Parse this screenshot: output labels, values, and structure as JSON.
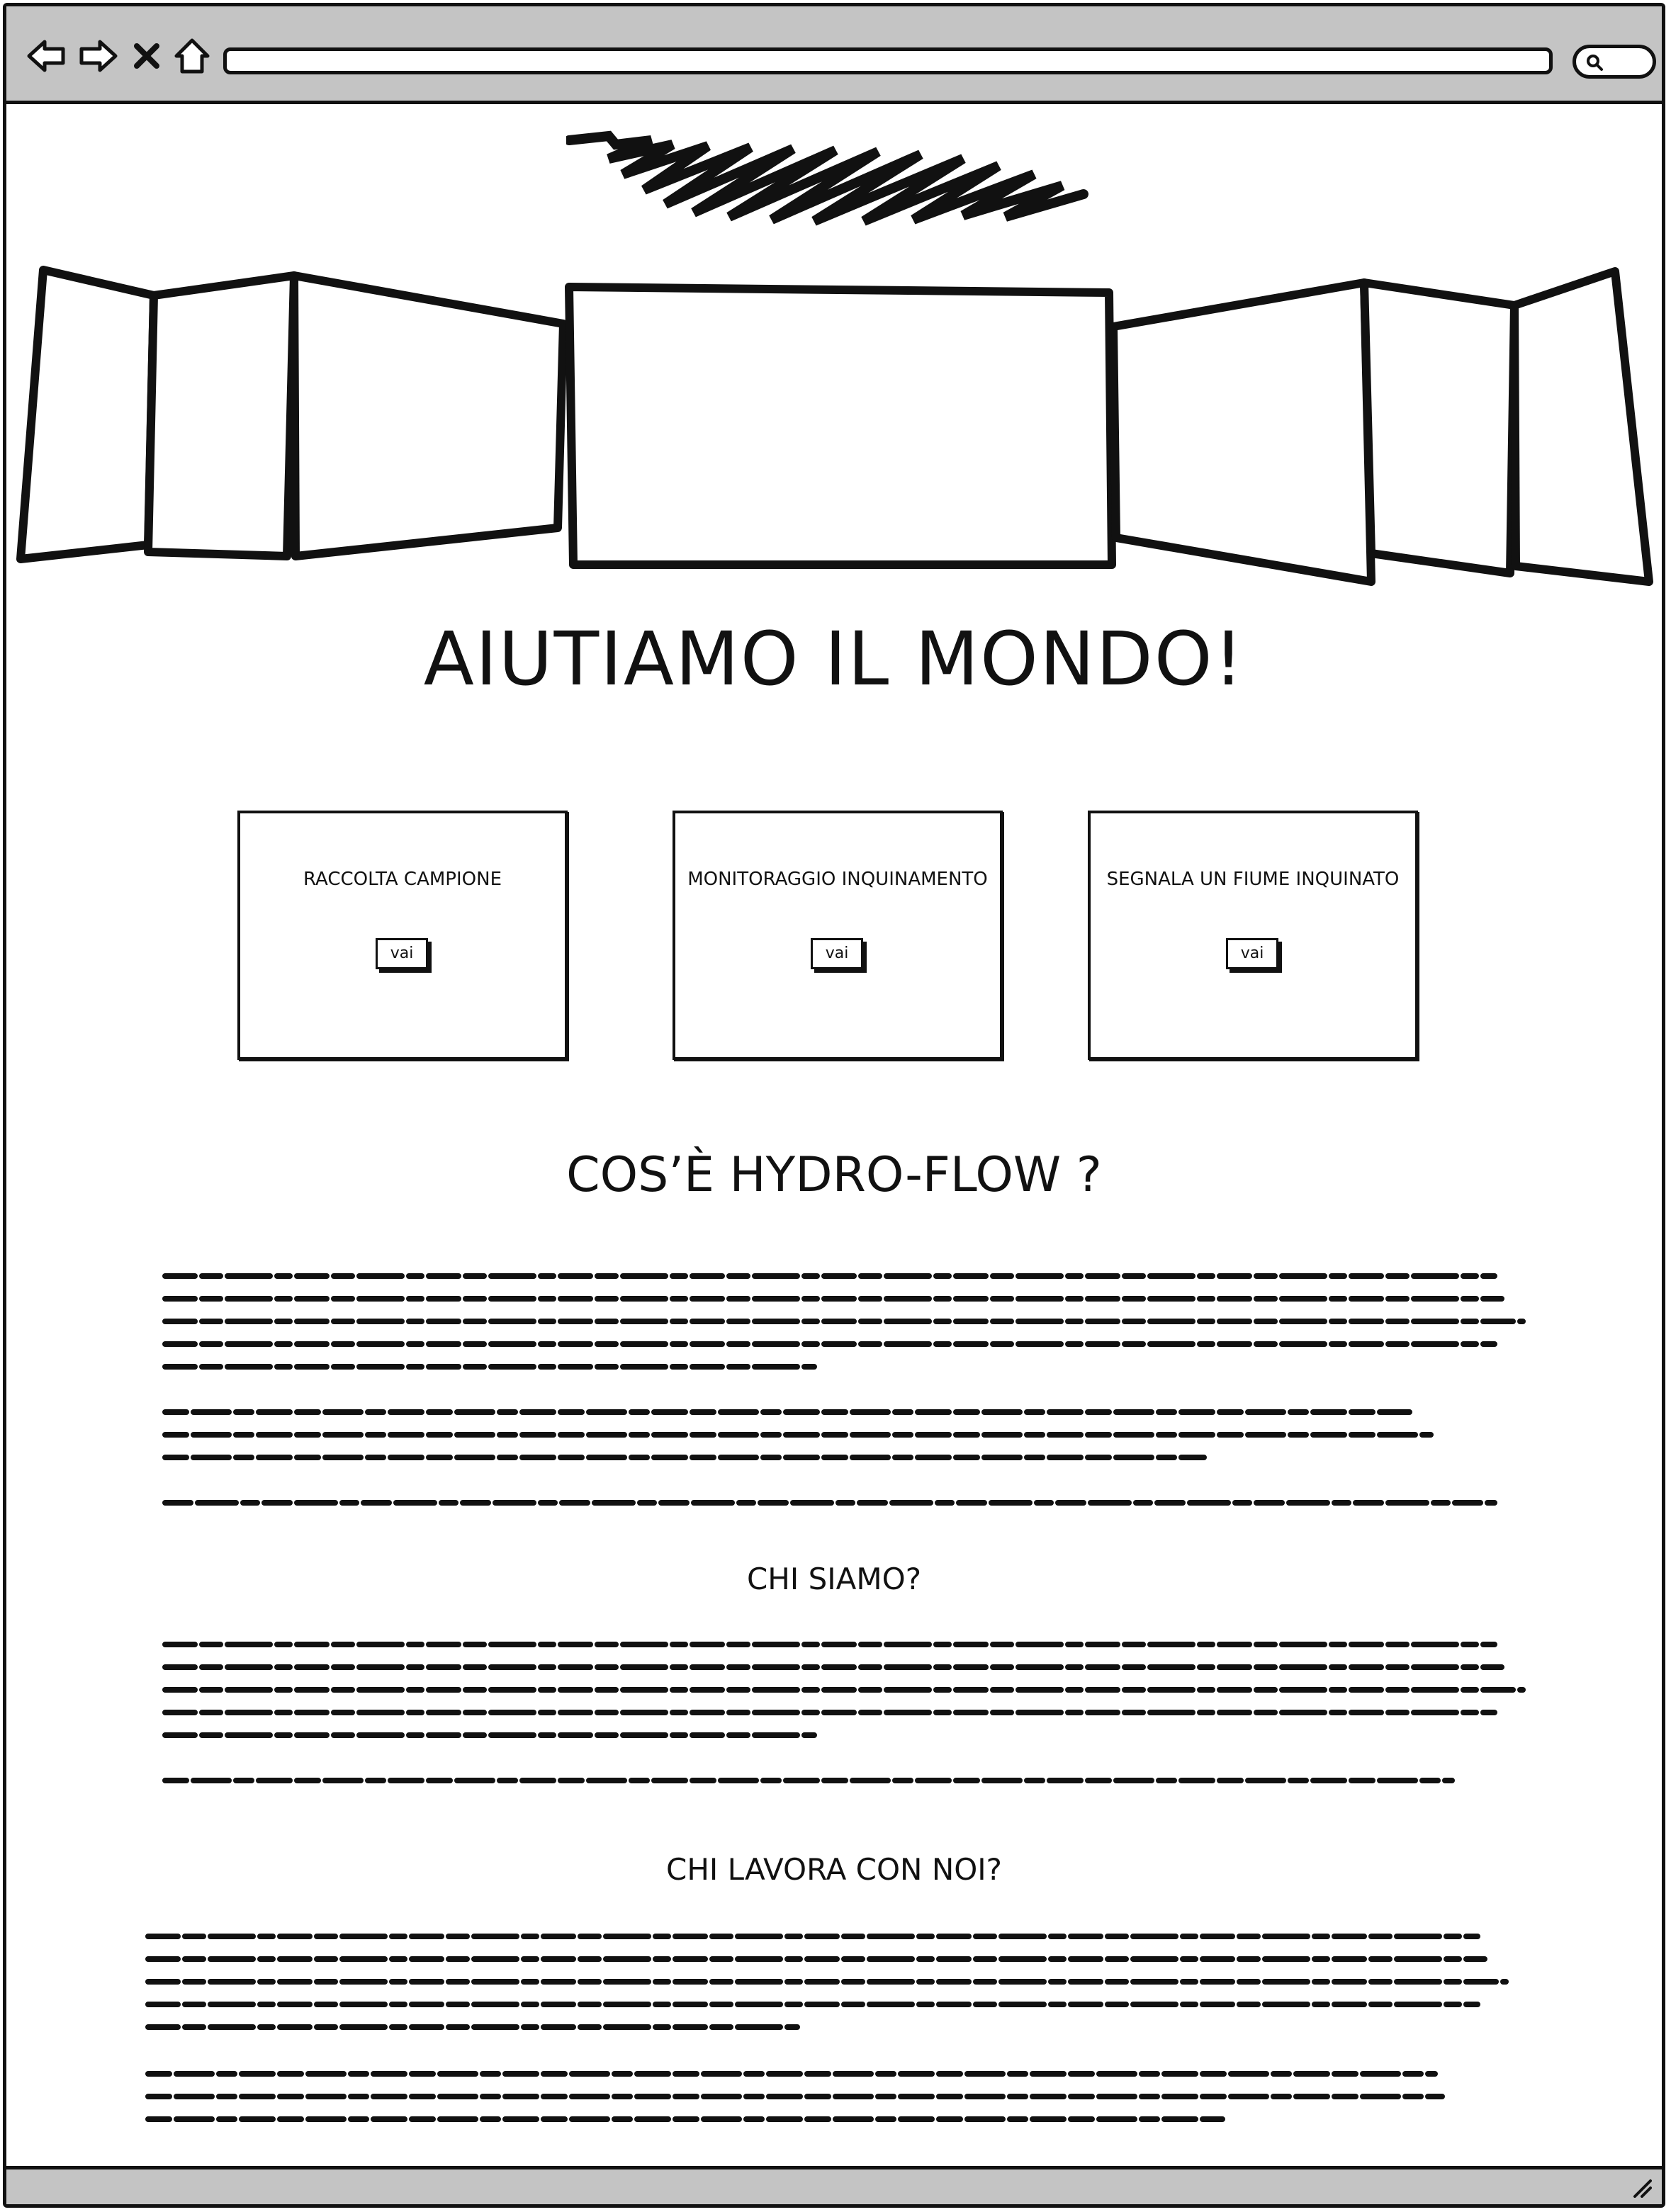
{
  "hero": {
    "title": "AIUTIAMO IL MONDO!"
  },
  "cards": [
    {
      "title": "RACCOLTA CAMPIONE",
      "button": "vai"
    },
    {
      "title": "MONITORAGGIO INQUINAMENTO",
      "button": "vai"
    },
    {
      "title": "SEGNALA UN FIUME INQUINATO",
      "button": "vai"
    }
  ],
  "sections": {
    "about": {
      "title": "COS’È HYDRO-FLOW  ?"
    },
    "who": {
      "title": "CHI SIAMO?"
    },
    "work": {
      "title": "CHI LAVORA CON NOI?"
    }
  },
  "icons": [
    "back-arrow-icon",
    "forward-arrow-icon",
    "close-icon",
    "home-icon",
    "search-icon",
    "resize-grip-icon"
  ]
}
